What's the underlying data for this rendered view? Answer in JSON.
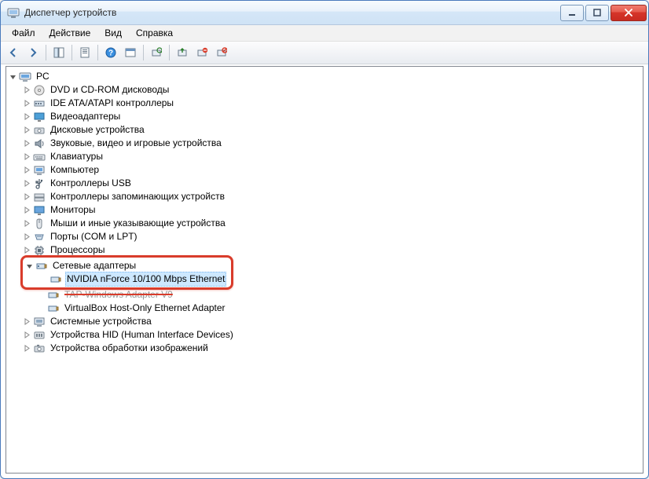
{
  "window": {
    "title": "Диспетчер устройств"
  },
  "menu": {
    "file": "Файл",
    "action": "Действие",
    "view": "Вид",
    "help": "Справка"
  },
  "tree": {
    "root": "PC",
    "dvd": "DVD и CD-ROM дисководы",
    "ide": "IDE ATA/ATAPI контроллеры",
    "video": "Видеоадаптеры",
    "disk": "Дисковые устройства",
    "sound": "Звуковые, видео и игровые устройства",
    "keyboard": "Клавиатуры",
    "computer": "Компьютер",
    "usb": "Контроллеры USB",
    "storage_ctrl": "Контроллеры запоминающих устройств",
    "monitor": "Мониторы",
    "mouse": "Мыши и иные указывающие устройства",
    "ports": "Порты (COM и LPT)",
    "cpu": "Процессоры",
    "net": "Сетевые адаптеры",
    "net_nvidia": "NVIDIA nForce 10/100 Mbps Ethernet",
    "net_tap": "TAP-Windows Adapter V9",
    "net_vbox": "VirtualBox Host-Only Ethernet Adapter",
    "system": "Системные устройства",
    "hid": "Устройства HID (Human Interface Devices)",
    "imaging": "Устройства обработки изображений"
  }
}
